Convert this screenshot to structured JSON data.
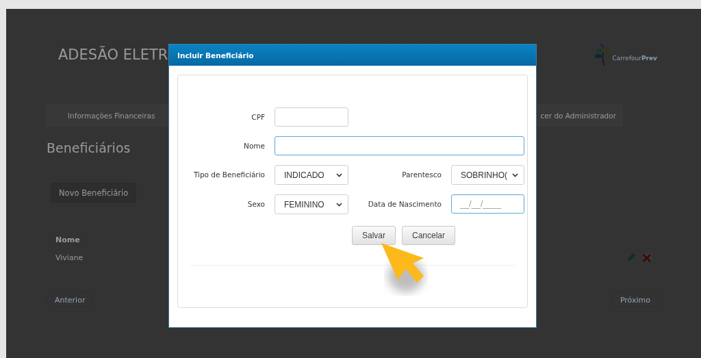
{
  "page": {
    "title": "ADESÃO ELETR",
    "logo_text": "Carrefour**Prev**",
    "nav": [
      "Informações Financeiras",
      "cer do Administrador"
    ],
    "heading": "Beneficiários",
    "new_button": "Novo Beneficiário",
    "table": {
      "columns": [
        "Nome"
      ],
      "rows": [
        {
          "cells": [
            "Viviane"
          ]
        }
      ]
    },
    "pagination": {
      "previous": "Anterior",
      "next": "Próximo"
    }
  },
  "dialog": {
    "title": "Incluir Beneficiário",
    "fields": [
      {
        "kind": "input",
        "label": "CPF",
        "focused": false
      },
      {
        "kind": "input",
        "label": "Nome",
        "focused": true
      },
      {
        "kind": "select",
        "label": "Tipo de Beneficiário",
        "value": "INDICADO",
        "focused": false
      },
      {
        "kind": "select",
        "label": "Parentesco",
        "value": "SOBRINHO(",
        "focused": false
      },
      {
        "kind": "select",
        "label": "Sexo",
        "value": "FEMININO",
        "focused": false
      },
      {
        "kind": "input",
        "label": "Data de Nascimento",
        "placeholder": "__/__/____",
        "focused": true
      }
    ],
    "buttons": [
      "Salvar",
      "Cancelar"
    ]
  }
}
